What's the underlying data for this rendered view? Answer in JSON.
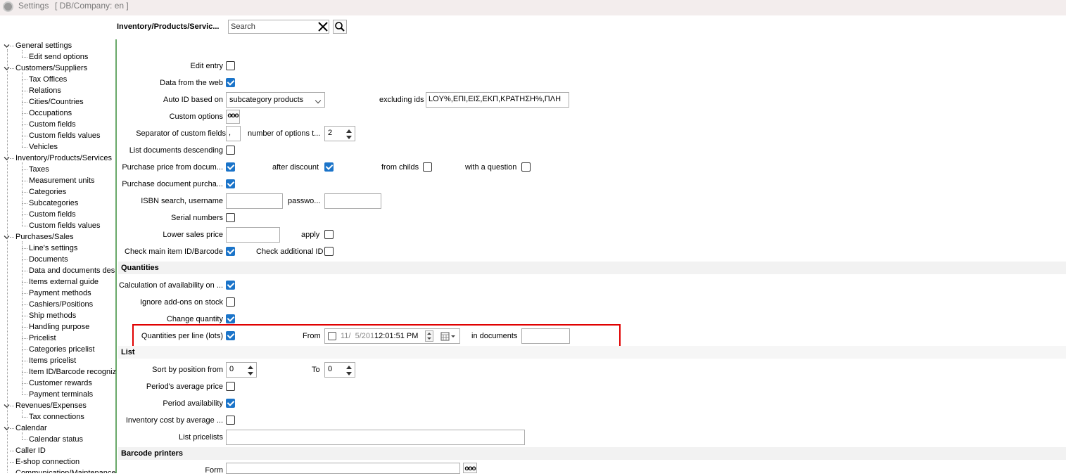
{
  "window": {
    "title": "Settings",
    "db": "[ DB/Company: en ]"
  },
  "toolbar": {
    "path": "Inventory/Products/Servic...",
    "search_placeholder": "Search"
  },
  "tree": [
    {
      "label": "General settings",
      "level": 0,
      "expanded": true
    },
    {
      "label": "Edit send options",
      "level": 1
    },
    {
      "label": "Customers/Suppliers",
      "level": 0,
      "expanded": true
    },
    {
      "label": "Tax Offices",
      "level": 1
    },
    {
      "label": "Relations",
      "level": 1
    },
    {
      "label": "Cities/Countries",
      "level": 1
    },
    {
      "label": "Occupations",
      "level": 1
    },
    {
      "label": "Custom fields",
      "level": 1
    },
    {
      "label": "Custom fields values",
      "level": 1
    },
    {
      "label": "Vehicles",
      "level": 1
    },
    {
      "label": "Inventory/Products/Services",
      "level": 0,
      "expanded": true
    },
    {
      "label": "Taxes",
      "level": 1
    },
    {
      "label": "Measurement units",
      "level": 1
    },
    {
      "label": "Categories",
      "level": 1
    },
    {
      "label": "Subcategories",
      "level": 1
    },
    {
      "label": "Custom fields",
      "level": 1
    },
    {
      "label": "Custom fields values",
      "level": 1
    },
    {
      "label": "Purchases/Sales",
      "level": 0,
      "expanded": true
    },
    {
      "label": "Line's settings",
      "level": 1
    },
    {
      "label": "Documents",
      "level": 1
    },
    {
      "label": "Data and documents desi",
      "level": 1
    },
    {
      "label": "Items external guide",
      "level": 1
    },
    {
      "label": "Payment methods",
      "level": 1
    },
    {
      "label": "Cashiers/Positions",
      "level": 1
    },
    {
      "label": "Ship methods",
      "level": 1
    },
    {
      "label": "Handling purpose",
      "level": 1
    },
    {
      "label": "Pricelist",
      "level": 1
    },
    {
      "label": "Categories pricelist",
      "level": 1
    },
    {
      "label": "Items pricelist",
      "level": 1
    },
    {
      "label": "Item ID/Barcode recognize",
      "level": 1
    },
    {
      "label": "Customer rewards",
      "level": 1
    },
    {
      "label": "Payment terminals",
      "level": 1
    },
    {
      "label": "Revenues/Expenses",
      "level": 0,
      "expanded": true
    },
    {
      "label": "Tax connections",
      "level": 1
    },
    {
      "label": "Calendar",
      "level": 0,
      "expanded": true
    },
    {
      "label": "Calendar status",
      "level": 1
    },
    {
      "label": "Caller ID",
      "level": 0
    },
    {
      "label": "E-shop connection",
      "level": 0
    },
    {
      "label": "Communication/Maintenance",
      "level": 0
    }
  ],
  "form": {
    "edit_entry": {
      "label": "Edit entry",
      "checked": false
    },
    "data_from_web": {
      "label": "Data from the web",
      "checked": true
    },
    "auto_id": {
      "label": "Auto ID based on",
      "value": "subcategory products"
    },
    "excluding_ids": {
      "label": "excluding ids",
      "value": "LOY%,ΕΠΙ,ΕΙΣ,ΕΚΠ,ΚΡΑΤΗΣΗ%,ΠΛΗ"
    },
    "custom_options": {
      "label": "Custom options",
      "button": "ooo"
    },
    "separator": {
      "label": "Separator of custom fields",
      "value": ","
    },
    "num_options": {
      "label": "number of options t...",
      "value": "2"
    },
    "list_docs_desc": {
      "label": "List documents descending",
      "checked": false
    },
    "purchase_price": {
      "label": "Purchase price from docum...",
      "checked": true
    },
    "after_discount": {
      "label": "after discount",
      "checked": true
    },
    "from_childs": {
      "label": "from childs",
      "checked": false
    },
    "with_question": {
      "label": "with a question",
      "checked": false
    },
    "purchase_doc": {
      "label": "Purchase document purcha...",
      "checked": true
    },
    "isbn": {
      "label": "ISBN search, username",
      "value": ""
    },
    "password": {
      "label": "passwo...",
      "value": ""
    },
    "serial_numbers": {
      "label": "Serial numbers",
      "checked": false
    },
    "lower_sales": {
      "label": "Lower sales price",
      "value": ""
    },
    "apply": {
      "label": "apply",
      "checked": false
    },
    "check_main_id": {
      "label": "Check main item ID/Barcode",
      "checked": true
    },
    "check_additional_id": {
      "label": "Check additional ID",
      "checked": false
    }
  },
  "quantities": {
    "title": "Quantities",
    "calc_availability": {
      "label": "Calculation of availability on ...",
      "checked": true
    },
    "ignore_addons": {
      "label": "Ignore add-ons on stock",
      "checked": false
    },
    "change_quantity": {
      "label": "Change quantity",
      "checked": true
    },
    "qty_per_line": {
      "label": "Quantities per line (lots)",
      "checked": true
    },
    "from": {
      "label": "From",
      "date": "11/  5/201",
      "time": "12:01:51 PM"
    },
    "in_documents": {
      "label": "in documents",
      "value": ""
    }
  },
  "list": {
    "title": "List",
    "sort_from": {
      "label": "Sort by position from",
      "value": "0"
    },
    "to": {
      "label": "To",
      "value": "0"
    },
    "period_avg": {
      "label": "Period's average price",
      "checked": false
    },
    "period_avail": {
      "label": "Period availability",
      "checked": true
    },
    "inv_cost": {
      "label": "Inventory cost by average ...",
      "checked": false
    },
    "list_pricelists": {
      "label": "List pricelists",
      "value": ""
    }
  },
  "barcode": {
    "title": "Barcode printers",
    "form": {
      "label": "Form",
      "value": "",
      "button": "ooo"
    }
  },
  "colors": {
    "accent": "#1b74c9",
    "highlight": "#e00000",
    "sidebar_border": "#6aa86a"
  }
}
